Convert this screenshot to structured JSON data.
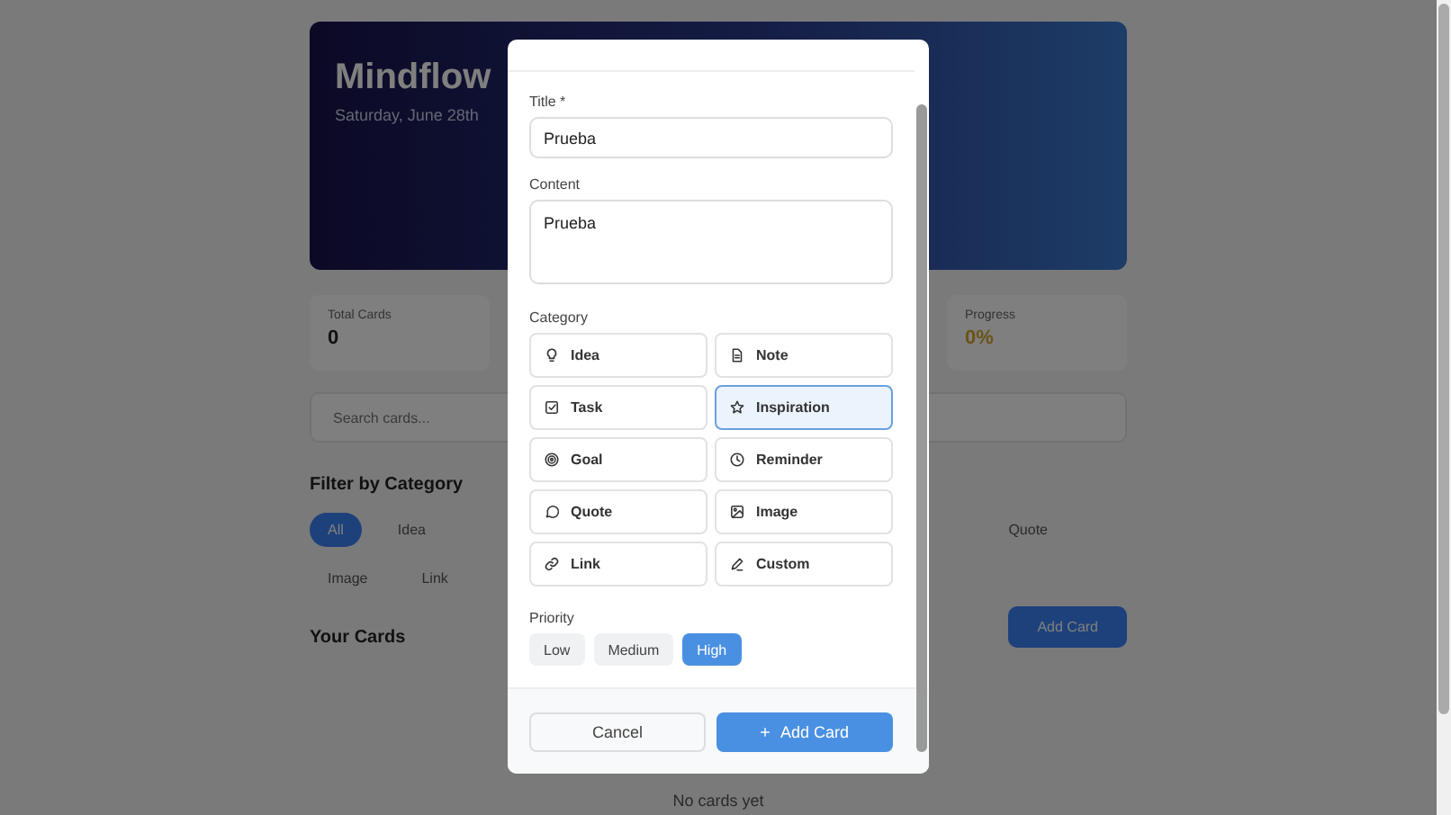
{
  "background": {
    "app_title": "Mindflow",
    "date": "Saturday, June 28th",
    "stats": [
      {
        "label": "Total Cards",
        "value": "0"
      },
      {
        "label": "Progress",
        "value": "0%"
      }
    ],
    "search": {
      "placeholder": "Search cards..."
    },
    "filter_heading": "Filter by Category",
    "filters": [
      {
        "label": "All",
        "selected": true
      },
      {
        "label": "Idea",
        "selected": false
      },
      {
        "label": "Quote",
        "selected": false
      },
      {
        "label": "Image",
        "selected": false
      },
      {
        "label": "Link",
        "selected": false
      }
    ],
    "cards_heading": "Your Cards",
    "add_button": "Add Card",
    "empty_text": "No cards yet"
  },
  "modal": {
    "title_field": {
      "label": "Title *",
      "value": "Prueba"
    },
    "content_field": {
      "label": "Content",
      "value": "Prueba"
    },
    "category_label": "Category",
    "categories": [
      {
        "label": "Idea",
        "selected": false
      },
      {
        "label": "Note",
        "selected": false
      },
      {
        "label": "Task",
        "selected": false
      },
      {
        "label": "Inspiration",
        "selected": true
      },
      {
        "label": "Goal",
        "selected": false
      },
      {
        "label": "Reminder",
        "selected": false
      },
      {
        "label": "Quote",
        "selected": false
      },
      {
        "label": "Image",
        "selected": false
      },
      {
        "label": "Link",
        "selected": false
      },
      {
        "label": "Custom",
        "selected": false
      }
    ],
    "priority_label": "Priority",
    "priorities": [
      {
        "label": "Low",
        "selected": false
      },
      {
        "label": "Medium",
        "selected": false
      },
      {
        "label": "High",
        "selected": true
      }
    ],
    "cancel_button": "Cancel",
    "submit_button": "Add Card"
  }
}
